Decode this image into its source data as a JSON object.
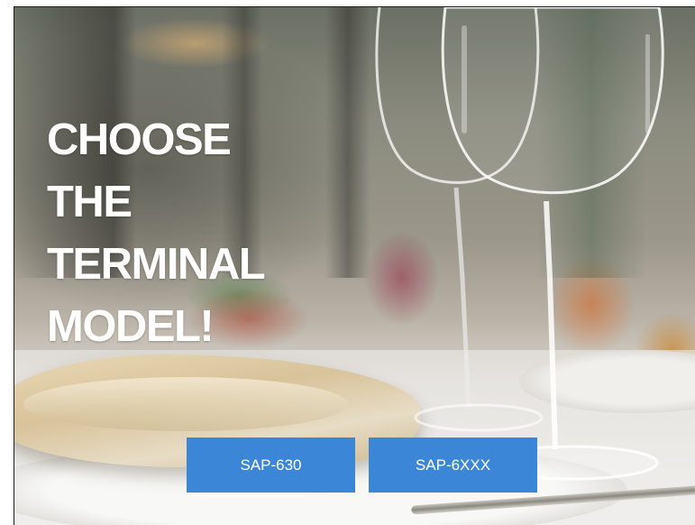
{
  "headline": {
    "lines": [
      "CHOOSE",
      "THE",
      "TERMINAL",
      "MODEL!"
    ]
  },
  "buttons": [
    {
      "label": "SAP-630"
    },
    {
      "label": "SAP-6XXX"
    }
  ],
  "colors": {
    "button_background": "#3b86d6",
    "button_text": "#ffffff",
    "headline_text": "#ffffff"
  }
}
